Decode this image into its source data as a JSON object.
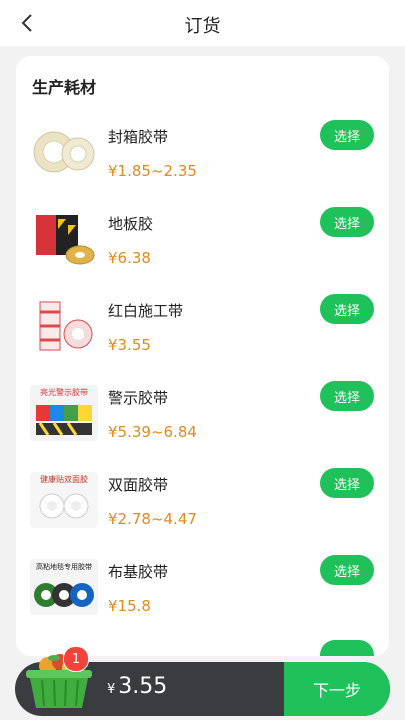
{
  "header": {
    "title": "订货"
  },
  "section": {
    "title": "生产耗材"
  },
  "products": [
    {
      "name": "封箱胶带",
      "price": "¥1.85~2.35",
      "button": "选择"
    },
    {
      "name": "地板胶",
      "price": "¥6.38",
      "button": "选择"
    },
    {
      "name": "红白施工带",
      "price": "¥3.55",
      "button": "选择"
    },
    {
      "name": "警示胶带",
      "price": "¥5.39~6.84",
      "button": "选择",
      "thumb_text": "亮光警示胶带"
    },
    {
      "name": "双面胶带",
      "price": "¥2.78~4.47",
      "button": "选择",
      "thumb_text": "健康贴双面胶"
    },
    {
      "name": "布基胶带",
      "price": "¥15.8",
      "button": "选择",
      "thumb_text": "高粘地毯专用胶带"
    }
  ],
  "cart": {
    "count": "1",
    "currency": "¥",
    "total": "3.55",
    "next_label": "下一步"
  },
  "colors": {
    "accent": "#1fc25a",
    "price": "#e38a1d",
    "cart_bg": "#3a3c40",
    "badge": "#f5423b"
  }
}
